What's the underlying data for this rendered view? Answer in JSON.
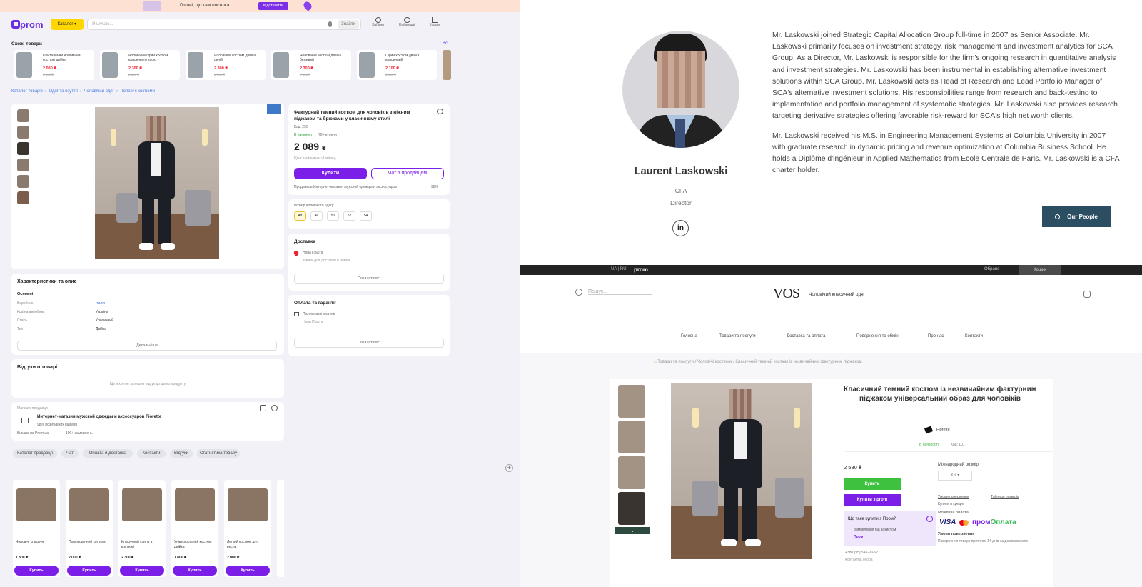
{
  "left": {
    "banner": {
      "text": "Готові, що там посилка",
      "button": "відстежити"
    },
    "header": {
      "logo": "prom",
      "catalog_button": "Каталог",
      "search_placeholder": "Я шукаю...",
      "search_button": "Знайти",
      "icons": [
        {
          "name": "Кабінет"
        },
        {
          "name": "Найкращі"
        },
        {
          "name": "Кошик"
        }
      ]
    },
    "similar": {
      "title": "Схожі товари",
      "all_link": "Всі",
      "items": [
        {
          "name": "Приталений чоловічий костюм двійка",
          "price": "2 080 ₴",
          "old": "2 600 ₴"
        },
        {
          "name": "Чоловічий сірий костюм класичного крою",
          "price": "2 300 ₴",
          "old": "2 600 ₴"
        },
        {
          "name": "Чоловічий костюм двійка синій",
          "price": "2 300 ₴",
          "old": "2 700 ₴"
        },
        {
          "name": "Чоловічий костюм двійка бежевий",
          "price": "2 300 ₴",
          "old": "2 600 ₴"
        },
        {
          "name": "Сірий костюм двійка класичний",
          "price": "2 100 ₴",
          "old": "2 450 ₴"
        }
      ]
    },
    "breadcrumbs": [
      "Каталог товарів",
      "Одяг та взуття",
      "Чоловічий одяг",
      "Чоловічі костюми"
    ],
    "product": {
      "title": "Фактурний темний костюм для чоловіків з ніжним піджаком та брюками у класичному стилі",
      "code": "Код: 295",
      "status": "В наявності",
      "sales": "70+ купили",
      "price": "2 089",
      "currency": "₴",
      "price_note": "Ціна: найнижча ~1 місяць",
      "buy_button": "Купити",
      "chat_button": "Чат з продавцем",
      "seller_line": "Продавець Интернет-магазин мужской одежды и аксессуаров",
      "rating": "98%"
    },
    "sizes": {
      "label": "Розмір чоловічого одягу",
      "options": [
        "48",
        "46",
        "50",
        "52",
        "54"
      ]
    },
    "delivery": {
      "title": "Доставка",
      "carrier": "Нова Пошта",
      "note": "Умови для доставки в регіоні",
      "more": "Показати всі"
    },
    "payment": {
      "title": "Оплата та гарантії",
      "method": "Післяплатні платежі",
      "carrier": "Нова Пошта",
      "more": "Показати всі"
    },
    "specs": {
      "title": "Характеристики та опис",
      "section": "Основні",
      "rows": [
        {
          "k": "Виробник",
          "v": "Італія"
        },
        {
          "k": "Країна виробник",
          "v": "Україна"
        },
        {
          "k": "Стиль",
          "v": "Класичний"
        },
        {
          "k": "Тип",
          "v": "Двійка"
        }
      ],
      "more": "Детальніше"
    },
    "reviews": {
      "title": "Відгуки о товарі",
      "note": "Ще ніхто не залишив відгук до цього продукту"
    },
    "seller": {
      "label": "Магазин продавця",
      "name": "Интернет-магазин мужской одежды и аксессуаров Fiorette",
      "stats": "98% позитивних відгуків",
      "since": "Більше на Prom.ua",
      "orders": "100+ замовлень"
    },
    "tags": [
      "Каталог продавця",
      "Чат",
      "Оплата й доставка",
      "Контакти",
      "Відгуки",
      "Статистика товару",
      "Більше у продавця"
    ],
    "bottom": {
      "items": [
        {
          "name": "Чоловічі класичні",
          "price": "1 800 ₴"
        },
        {
          "name": "Повсякденний костюм",
          "price": "2 000 ₴"
        },
        {
          "name": "Класичний стиль в костюмі",
          "price": "2 300 ₴"
        },
        {
          "name": "Універсальний костюм двійка",
          "price": "1 800 ₴"
        },
        {
          "name": "Легкий костюм для весни",
          "price": "2 000 ₴"
        }
      ],
      "buy_label": "Купить"
    }
  },
  "profile": {
    "name": "Laurent Laskowski",
    "credential": "CFA",
    "role": "Director",
    "linkedin": "in",
    "button": "Our People",
    "para1": "Mr. Laskowski joined Strategic Capital Allocation Group full-time in 2007 as Senior Associate. Mr. Laskowski primarily focuses on investment strategy, risk management and investment analytics for SCA Group. As a Director, Mr. Laskowski is responsible for the firm's ongoing research in quantitative analysis and investment strategies. Mr. Laskowski has been instrumental in establishing alternative investment solutions within SCA Group. Mr. Laskowski acts as Head of Research and Lead Portfolio Manager of SCA's alternative investment solutions. His responsibilities range from research and back-testing to implementation and portfolio management of systematic strategies. Mr. Laskowski also provides research targeting derivative strategies offering favorable risk-reward for SCA's high net worth clients.",
    "para2": "Mr. Laskowski received his M.S. in Engineering Management Systems at Columbia University in 2007 with graduate research in dynamic pricing and revenue optimization at Columbia Business School. He holds a Diplôme d'ingénieur in Applied Mathematics from Ecole Centrale de Paris. Mr. Laskowski is a CFA charter holder."
  },
  "vos": {
    "topbar": {
      "lang": "UA | RU",
      "brand": "prom",
      "right1": "Обране",
      "right2": "Кошик"
    },
    "search_placeholder": "Пошук...",
    "logo": "VOS",
    "tagline": "Чоловічий класичний одяг",
    "nav": [
      "Головна",
      "Товари та послуги",
      "Доставка та оплата",
      "Повернення та обмін",
      "Про нас",
      "Контакти"
    ],
    "breadcrumb": "Товари та послуги / Чоловічі костюми / Класичний темний костюм із незвичайним фактурним піджаком",
    "product": {
      "title": "Класичний темний костюм із незвичайним фактурним піджаком універсальний образ для чоловіків",
      "brand": "Fiorette",
      "stock": "В наявності",
      "code": "Код: 101",
      "price": "2 580 ₴",
      "size_label": "Міжнародний розмір",
      "size_value": "XS",
      "buy_button": "Купить",
      "prom_button": "Купити з prom",
      "prom_box_title": "Що таке купити з Пром?",
      "prom_box_text": "Замовлення під захистом",
      "prom_box_brand": "Пром",
      "links": [
        "Умови повернення",
        "Таблиця розмірів",
        "Купити в кредит"
      ],
      "payment_label": "Можлива оплата",
      "payment_prom": "пром",
      "payment_pay": "Оплата",
      "warranty": "Умови повернення",
      "warranty_text": "Повернення товару протягом 14 днів за домовленістю",
      "phone": "+380 (95) 545-90-52",
      "contact_label": "Контактна особа"
    }
  }
}
